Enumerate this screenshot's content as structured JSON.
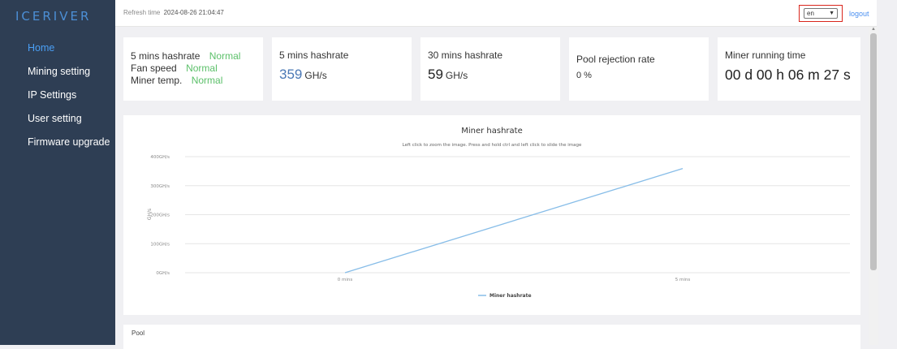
{
  "brand": {
    "logo_text": "ICERIVER"
  },
  "sidebar": {
    "items": [
      {
        "label": "Home",
        "active": true
      },
      {
        "label": "Mining setting"
      },
      {
        "label": "IP Settings"
      },
      {
        "label": "User setting"
      },
      {
        "label": "Firmware upgrade"
      }
    ]
  },
  "header": {
    "refresh_label": "Refresh time",
    "refresh_time": "2024-08-26 21:04:47",
    "language": "en",
    "logout": "logout"
  },
  "status": {
    "hashrate_label": "5 mins hashrate",
    "hashrate_status": "Normal",
    "fan_label": "Fan speed",
    "fan_status": "Normal",
    "temp_label": "Miner temp.",
    "temp_status": "Normal"
  },
  "cards": {
    "h5": {
      "title": "5 mins hashrate",
      "value": "359",
      "unit": "GH/s"
    },
    "h30": {
      "title": "30 mins hashrate",
      "value": "59",
      "unit": "GH/s"
    },
    "rejection": {
      "title": "Pool rejection rate",
      "value": "0 %"
    },
    "runtime": {
      "title": "Miner running time",
      "value": "00 d 00 h 06 m 27 s"
    }
  },
  "chart_data": {
    "type": "line",
    "title": "Miner hashrate",
    "subtitle": "Left click to zoom the image. Press and hold ctrl and left click to slide the image",
    "ylabel": "GH/s",
    "categories": [
      "0 mins",
      "5 mins"
    ],
    "y_ticks": [
      "0GH/s",
      "100GH/s",
      "200GH/s",
      "300GH/s",
      "400GH/s"
    ],
    "ylim": [
      0,
      400
    ],
    "series": [
      {
        "name": "Miner hashrate",
        "values": [
          0,
          359
        ]
      }
    ],
    "grid": true,
    "legend": "bottom-center",
    "color": "#87bde8"
  },
  "pool": {
    "title": "Pool"
  }
}
